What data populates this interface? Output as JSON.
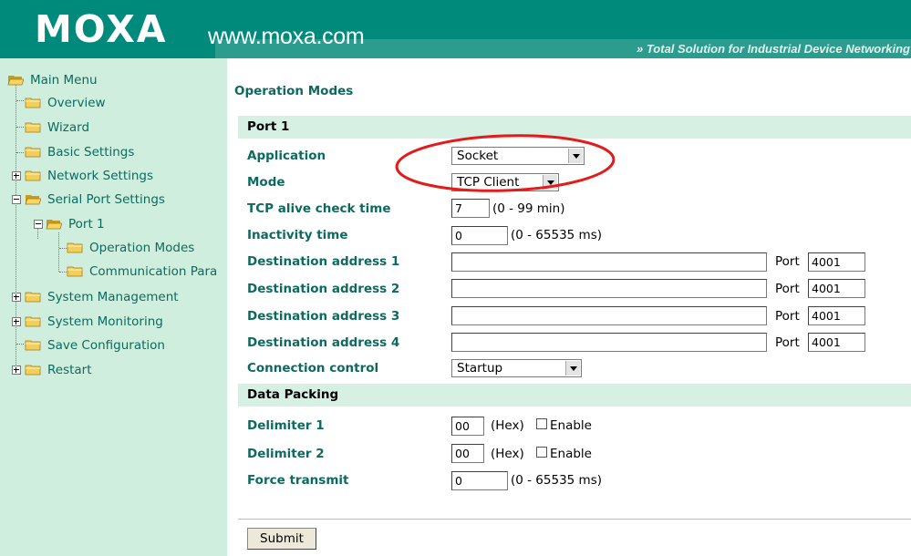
{
  "header": {
    "logo_text": "MOXA",
    "site_url": "www.moxa.com",
    "tagline": "» Total Solution for Industrial Device Networking"
  },
  "colors": {
    "brand_teal": "#008a7c",
    "sidebar_bg": "#cfeedd",
    "label_green": "#0d6a5e",
    "section_bg": "#d6f0e4",
    "folder_yellow": "#f2cf5c",
    "annotation_red": "#e21b1b"
  },
  "sidebar": {
    "items": [
      {
        "label": "Main Menu",
        "icon": "open-folder-icon"
      },
      {
        "label": "Overview",
        "icon": "folder-icon"
      },
      {
        "label": "Wizard",
        "icon": "folder-icon"
      },
      {
        "label": "Basic Settings",
        "icon": "folder-icon"
      },
      {
        "label": "Network Settings",
        "icon": "folder-icon",
        "expander": "plus"
      },
      {
        "label": "Serial Port Settings",
        "icon": "open-folder-icon",
        "expander": "minus"
      },
      {
        "label": "Port 1",
        "icon": "open-folder-icon",
        "expander": "minus"
      },
      {
        "label": "Operation Modes",
        "icon": "folder-icon"
      },
      {
        "label": "Communication Para",
        "icon": "folder-icon"
      },
      {
        "label": "System Management",
        "icon": "folder-icon",
        "expander": "plus"
      },
      {
        "label": "System Monitoring",
        "icon": "folder-icon",
        "expander": "plus"
      },
      {
        "label": "Save Configuration",
        "icon": "folder-icon"
      },
      {
        "label": "Restart",
        "icon": "folder-icon",
        "expander": "plus"
      }
    ]
  },
  "main": {
    "title": "Operation Modes",
    "port_section": "Port 1",
    "application_label": "Application",
    "application_value": "Socket",
    "mode_label": "Mode",
    "mode_value": "TCP Client",
    "tcp_alive_label": "TCP alive check time",
    "tcp_alive_value": "7",
    "tcp_alive_hint": "(0 - 99 min)",
    "inactivity_label": "Inactivity time",
    "inactivity_value": "0",
    "inactivity_hint": "(0 - 65535 ms)",
    "destinations": [
      {
        "label": "Destination address 1",
        "address": "",
        "port_label": "Port",
        "port": "4001"
      },
      {
        "label": "Destination address 2",
        "address": "",
        "port_label": "Port",
        "port": "4001"
      },
      {
        "label": "Destination address 3",
        "address": "",
        "port_label": "Port",
        "port": "4001"
      },
      {
        "label": "Destination address 4",
        "address": "",
        "port_label": "Port",
        "port": "4001"
      }
    ],
    "connection_control_label": "Connection control",
    "connection_control_value": "Startup",
    "data_packing_section": "Data Packing",
    "delimiter1_label": "Delimiter 1",
    "delimiter1_value": "00",
    "delimiter1_hex": "(Hex)",
    "delimiter1_enable": "Enable",
    "delimiter2_label": "Delimiter 2",
    "delimiter2_value": "00",
    "delimiter2_hex": "(Hex)",
    "delimiter2_enable": "Enable",
    "force_transmit_label": "Force transmit",
    "force_transmit_value": "0",
    "force_transmit_hint": "(0 - 65535 ms)",
    "submit_label": "Submit"
  }
}
